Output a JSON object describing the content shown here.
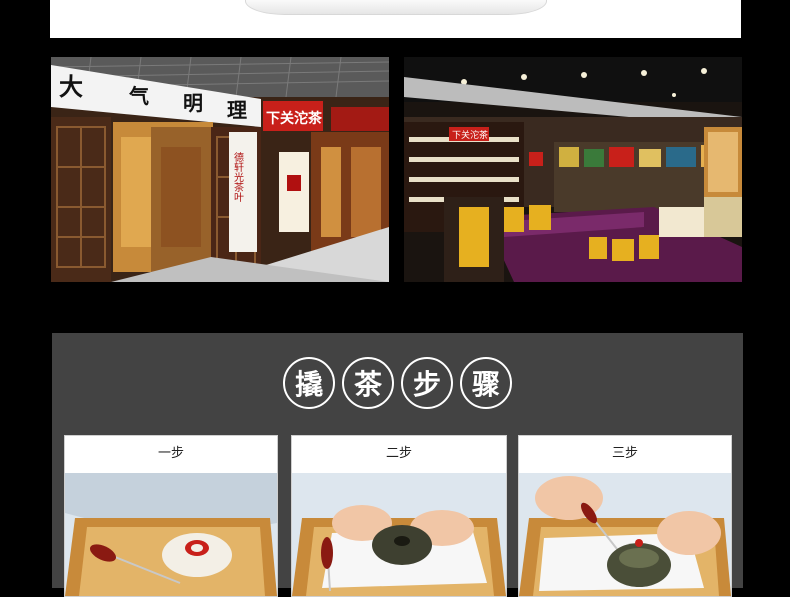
{
  "store_photos": {
    "left_sign_chars": [
      "大",
      "气",
      "明",
      "理"
    ],
    "left_store_name": "下关沱茶",
    "left_poster_text": "德轩光茶叶",
    "right_shelf_sign": "下关沱茶"
  },
  "steps_section": {
    "title_chars": [
      "撬",
      "茶",
      "步",
      "骤"
    ],
    "steps": [
      {
        "label": "一步"
      },
      {
        "label": "二步"
      },
      {
        "label": "三步"
      }
    ]
  },
  "colors": {
    "panel_bg": "#434343",
    "page_bg": "#000000",
    "accent_red": "#c8201a"
  }
}
